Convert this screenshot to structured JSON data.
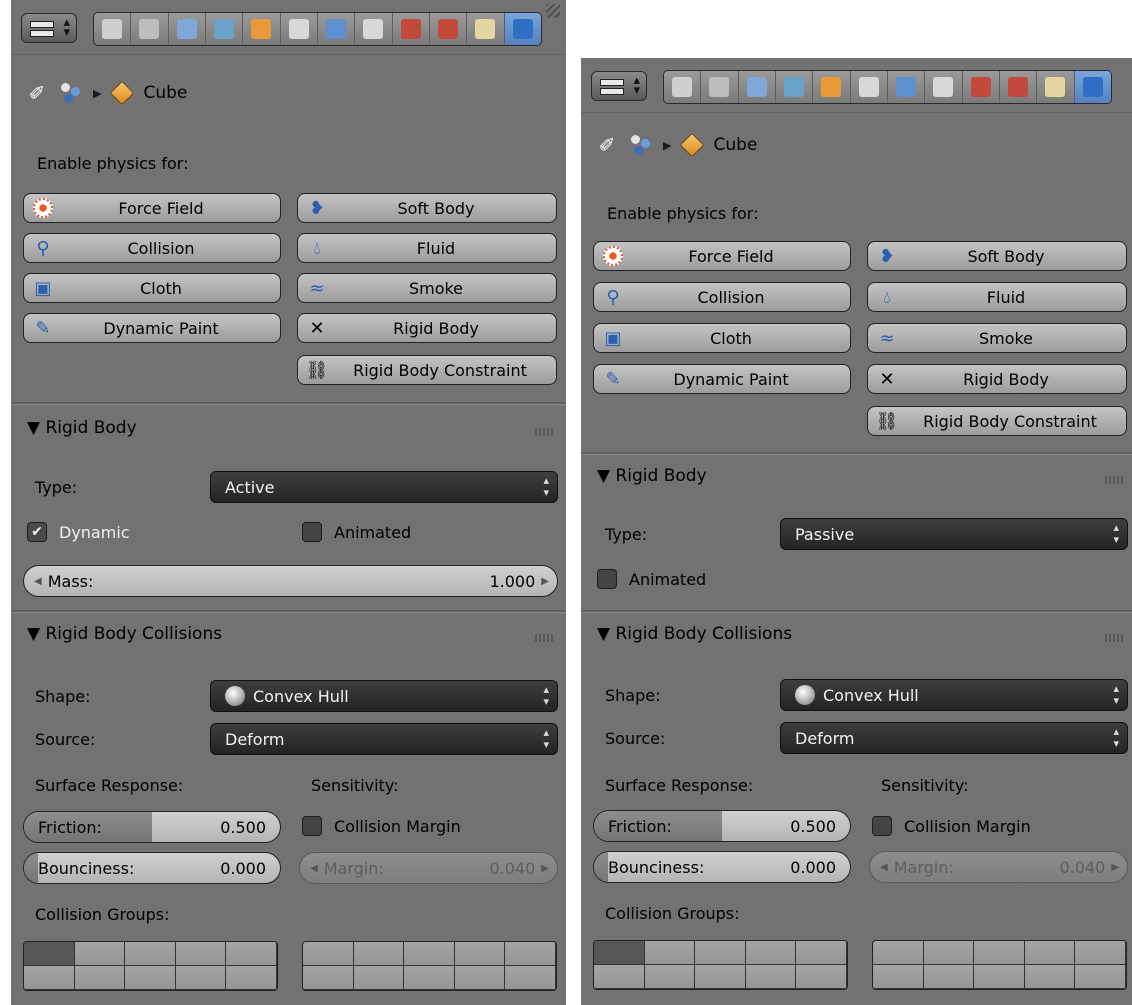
{
  "left": {
    "tabs": [
      {
        "icon": "render-icon",
        "color": "#cfcfcf"
      },
      {
        "icon": "render-layers-icon",
        "color": "#bdbdbd"
      },
      {
        "icon": "scene-icon",
        "color": "#7fa8d8"
      },
      {
        "icon": "world-icon",
        "color": "#6aa3c9"
      },
      {
        "icon": "object-icon",
        "color": "#e89a3a"
      },
      {
        "icon": "constraints-icon",
        "color": "#d8d8d8"
      },
      {
        "icon": "modifiers-icon",
        "color": "#5e8fd1"
      },
      {
        "icon": "data-icon",
        "color": "#d8d8d8"
      },
      {
        "icon": "material-icon",
        "color": "#c24a3c"
      },
      {
        "icon": "texture-icon",
        "color": "#c24a3c"
      },
      {
        "icon": "particles-icon",
        "color": "#e3d6a0"
      },
      {
        "icon": "physics-icon",
        "color": "#2f6fc2",
        "active": true
      }
    ],
    "breadcrumb": {
      "object": "Cube"
    },
    "enable_label": "Enable physics for:",
    "buttons": {
      "force_field": "Force Field",
      "soft_body": "Soft Body",
      "collision": "Collision",
      "fluid": "Fluid",
      "cloth": "Cloth",
      "smoke": "Smoke",
      "dynamic_paint": "Dynamic Paint",
      "rigid_body": "Rigid Body",
      "rigid_body_constraint": "Rigid Body Constraint"
    },
    "rigid_body": {
      "header": "▼ Rigid Body",
      "type_label": "Type:",
      "type_value": "Active",
      "dynamic_label": "Dynamic",
      "dynamic_checked": true,
      "animated_label": "Animated",
      "animated_checked": false,
      "mass_label": "Mass:",
      "mass_value": "1.000"
    },
    "collisions": {
      "header": "▼ Rigid Body Collisions",
      "shape_label": "Shape:",
      "shape_value": "Convex Hull",
      "source_label": "Source:",
      "source_value": "Deform",
      "surface_label": "Surface Response:",
      "sensitivity_label": "Sensitivity:",
      "friction_label": "Friction:",
      "friction_value": "0.500",
      "friction_level": 0.5,
      "bounciness_label": "Bounciness:",
      "bounciness_value": "0.000",
      "bounciness_level": 0.0,
      "collision_margin_label": "Collision Margin",
      "margin_label": "Margin:",
      "margin_value": "0.040",
      "groups_label": "Collision Groups:"
    }
  },
  "right": {
    "breadcrumb": {
      "object": "Cube"
    },
    "enable_label": "Enable physics for:",
    "buttons": {
      "force_field": "Force Field",
      "soft_body": "Soft Body",
      "collision": "Collision",
      "fluid": "Fluid",
      "cloth": "Cloth",
      "smoke": "Smoke",
      "dynamic_paint": "Dynamic Paint",
      "rigid_body": "Rigid Body",
      "rigid_body_constraint": "Rigid Body Constraint"
    },
    "rigid_body": {
      "header": "▼ Rigid Body",
      "type_label": "Type:",
      "type_value": "Passive",
      "animated_label": "Animated",
      "animated_checked": false
    },
    "collisions": {
      "header": "▼ Rigid Body Collisions",
      "shape_label": "Shape:",
      "shape_value": "Convex Hull",
      "source_label": "Source:",
      "source_value": "Deform",
      "surface_label": "Surface Response:",
      "sensitivity_label": "Sensitivity:",
      "friction_label": "Friction:",
      "friction_value": "0.500",
      "friction_level": 0.5,
      "bounciness_label": "Bounciness:",
      "bounciness_value": "0.000",
      "bounciness_level": 0.0,
      "collision_margin_label": "Collision Margin",
      "margin_label": "Margin:",
      "margin_value": "0.040",
      "groups_label": "Collision Groups:"
    }
  },
  "colors": {
    "panel": "#727272",
    "dropdown": "#2f2f2f",
    "button": "#b0b0b0",
    "active_tab": "#5a86c6"
  }
}
